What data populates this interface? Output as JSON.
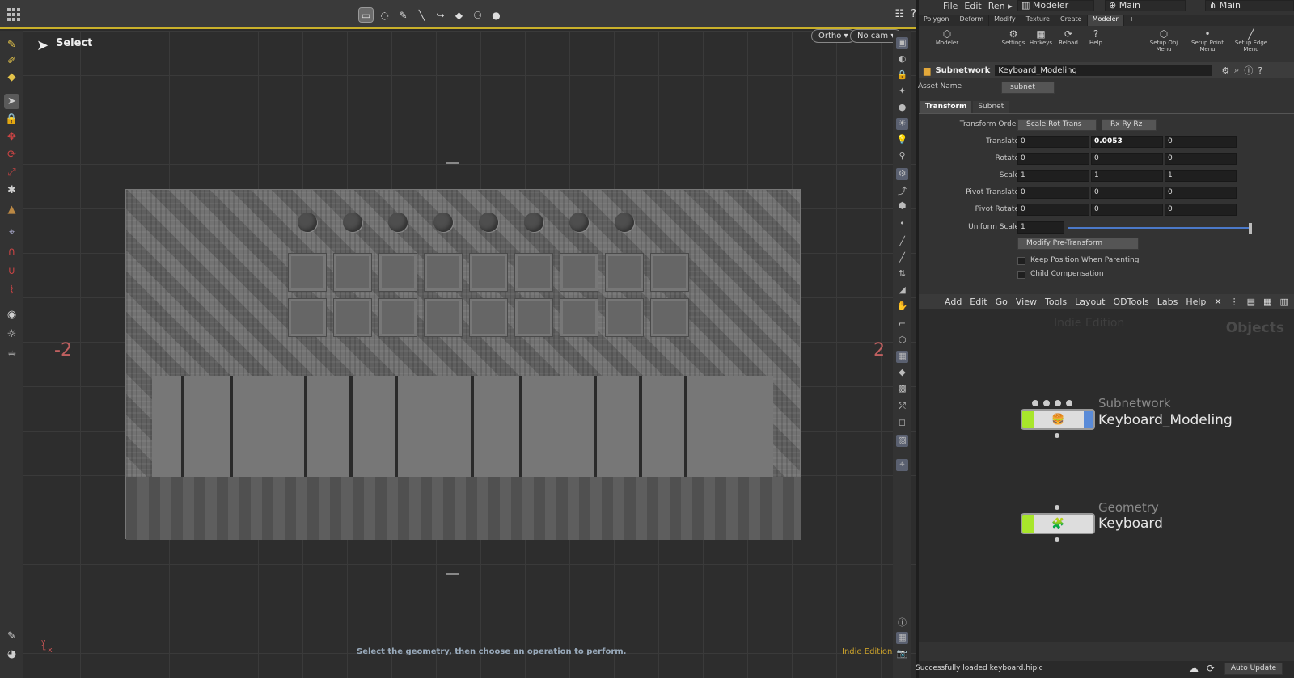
{
  "viewport": {
    "tool_label": "Select",
    "view_mode": "Ortho ▾",
    "camera": "No cam ▾",
    "axis_left": "-2",
    "axis_right": "2",
    "status_message": "Select the geometry, then choose an operation to perform.",
    "edition": "Indie Edition"
  },
  "menubar": {
    "items": [
      "File",
      "Edit",
      "Ren ▸"
    ],
    "desktop": "Modeler",
    "context": "Main",
    "context2": "Main"
  },
  "shelf": {
    "tabs": [
      "Polygon",
      "Deform",
      "Modify",
      "Texture",
      "Create",
      "Modeler",
      "+"
    ],
    "active_tab": "Modeler",
    "tools": [
      {
        "label": "Modeler",
        "icon": "⬡"
      },
      {
        "label": "",
        "icon": ""
      },
      {
        "label": "Settings",
        "icon": "⚙"
      },
      {
        "label": "Hotkeys",
        "icon": "▦"
      },
      {
        "label": "Reload",
        "icon": "⟳"
      },
      {
        "label": "Help",
        "icon": "?"
      },
      {
        "label": "",
        "icon": ""
      },
      {
        "label": "Setup Obj Menu",
        "icon": "⬡"
      },
      {
        "label": "Setup Point Menu",
        "icon": "•"
      },
      {
        "label": "Setup Edge Menu",
        "icon": "╱"
      }
    ]
  },
  "parameters": {
    "node_type": "Subnetwork",
    "node_name": "Keyboard_Modeling",
    "asset_name_label": "Asset Name",
    "asset_name_value": "subnet",
    "tabs": [
      "Transform",
      "Subnet"
    ],
    "transform_order_label": "Transform Order",
    "transform_order": "Scale Rot Trans",
    "rotate_order": "Rx Ry Rz",
    "rows": [
      {
        "label": "Translate",
        "values": [
          "0",
          "0.0053",
          "0"
        ]
      },
      {
        "label": "Rotate",
        "values": [
          "0",
          "0",
          "0"
        ]
      },
      {
        "label": "Scale",
        "values": [
          "1",
          "1",
          "1"
        ]
      },
      {
        "label": "Pivot Translate",
        "values": [
          "0",
          "0",
          "0"
        ]
      },
      {
        "label": "Pivot Rotate",
        "values": [
          "0",
          "0",
          "0"
        ]
      }
    ],
    "uniform_scale_label": "Uniform Scale",
    "uniform_scale": "1",
    "modify_pre_transform": "Modify Pre-Transform",
    "keep_position": "Keep Position When Parenting",
    "child_compensation": "Child Compensation"
  },
  "network": {
    "menu": [
      "Add",
      "Edit",
      "Go",
      "View",
      "Tools",
      "Layout",
      "ODTools",
      "Labs",
      "Help"
    ],
    "watermark": "Indie Edition",
    "context_label": "Objects",
    "nodes": [
      {
        "type": "Subnetwork",
        "name": "Keyboard_Modeling",
        "icon": "🍔"
      },
      {
        "type": "Geometry",
        "name": "Keyboard",
        "icon": "🧩"
      }
    ]
  },
  "statusbar": {
    "message": "Successfully loaded keyboard.hiplc",
    "auto_update": "Auto Update"
  }
}
